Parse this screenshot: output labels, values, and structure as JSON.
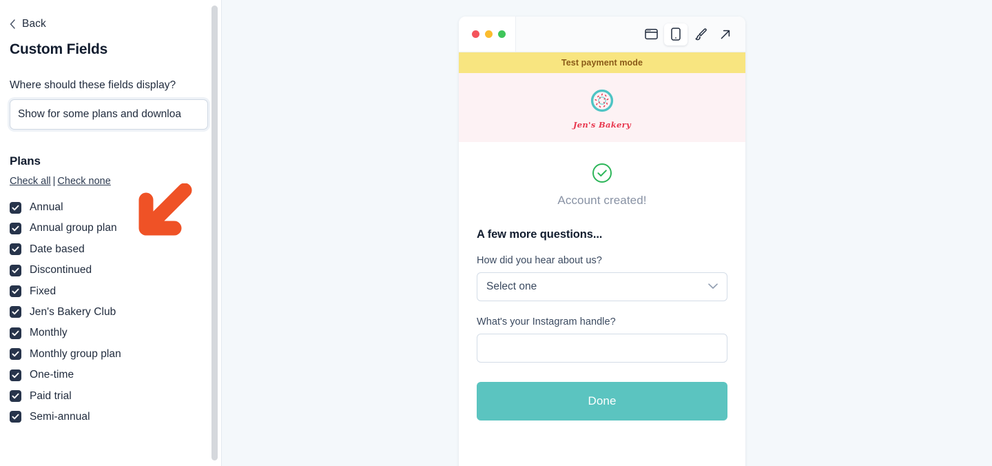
{
  "sidebar": {
    "back_label": "Back",
    "back_icon": "chevron-left-icon",
    "title": "Custom Fields",
    "display_question": "Where should these fields display?",
    "display_select_value": "Show for some plans and downloa",
    "plans_heading": "Plans",
    "check_all_label": "Check all",
    "check_separator": "|",
    "check_none_label": "Check none",
    "plans": [
      {
        "label": "Annual",
        "checked": true
      },
      {
        "label": "Annual group plan",
        "checked": true
      },
      {
        "label": "Date based",
        "checked": true
      },
      {
        "label": "Discontinued",
        "checked": true
      },
      {
        "label": "Fixed",
        "checked": true
      },
      {
        "label": "Jen's Bakery Club",
        "checked": true
      },
      {
        "label": "Monthly",
        "checked": true
      },
      {
        "label": "Monthly group plan",
        "checked": true
      },
      {
        "label": "One-time",
        "checked": true
      },
      {
        "label": "Paid trial",
        "checked": true
      },
      {
        "label": "Semi-annual",
        "checked": true
      }
    ]
  },
  "preview": {
    "chrome": {
      "traffic_lights": [
        "close-red",
        "minimize-yellow",
        "maximize-green"
      ],
      "tools": [
        {
          "name": "desktop-preview-icon",
          "active": false
        },
        {
          "name": "mobile-preview-icon",
          "active": true
        },
        {
          "name": "paintbrush-icon",
          "active": false
        },
        {
          "name": "open-external-icon",
          "active": false
        }
      ]
    },
    "test_banner": "Test payment mode",
    "brand_name": "Jen's Bakery",
    "brand_logo": "donut-logo-icon",
    "success_icon": "check-circle-icon",
    "success_text": "Account created!",
    "questions_heading": "A few more questions...",
    "field_1": {
      "label": "How did you hear about us?",
      "value": "Select one",
      "chevron": "chevron-down-icon"
    },
    "field_2": {
      "label": "What's your Instagram handle?",
      "value": "",
      "placeholder": ""
    },
    "submit_label": "Done"
  },
  "annotation": {
    "arrow": "arrow-down-left-icon",
    "color": "#ef5226"
  },
  "colors": {
    "accent_teal": "#5bc4c0",
    "banner_yellow": "#f8e580",
    "banner_text": "#8a5a18",
    "brand_red": "#e8384f",
    "success_green": "#2eb65a",
    "checkbox_navy": "#27344b",
    "stage_bg": "#f4f8fb"
  }
}
